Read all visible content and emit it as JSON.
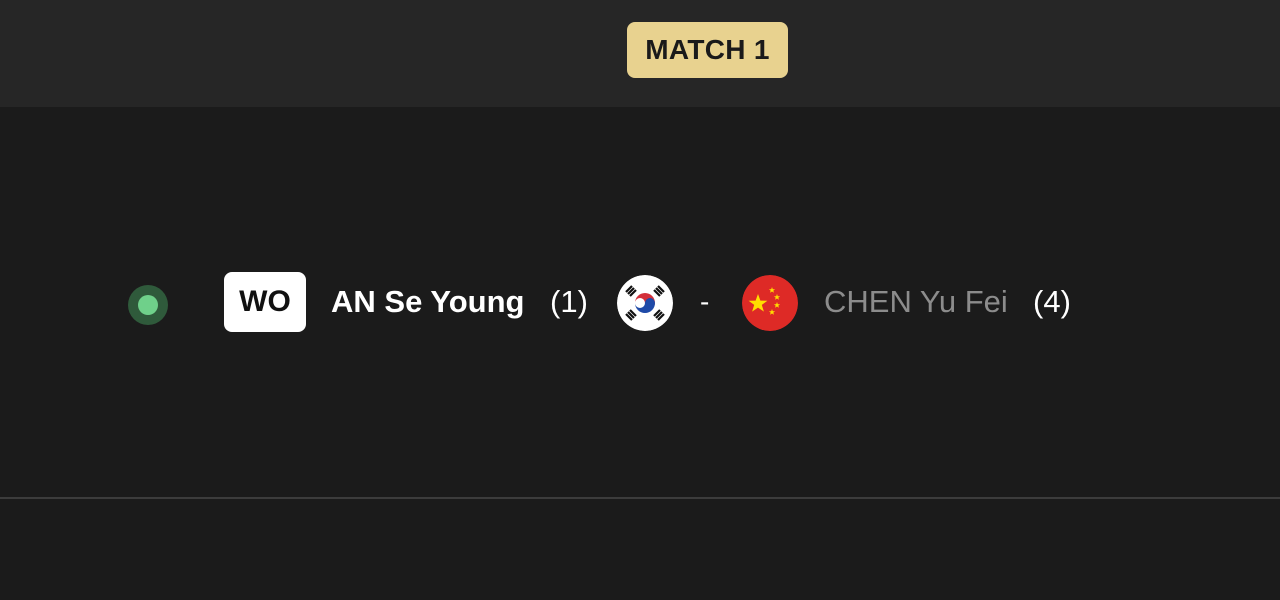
{
  "header": {
    "match_label": "MATCH 1"
  },
  "match": {
    "status_badge": "WO",
    "status_color": "#6fd08a",
    "player_a": {
      "name": "AN Se Young",
      "seed": "(1)",
      "flag_icon": "south-korea-flag-icon"
    },
    "separator": "-",
    "player_b": {
      "name": "CHEN Yu Fei",
      "seed": "(4)",
      "flag_icon": "china-flag-icon"
    }
  },
  "colors": {
    "badge_accent": "#e8d28f",
    "background": "#1b1b1b",
    "header_background": "#262626"
  }
}
